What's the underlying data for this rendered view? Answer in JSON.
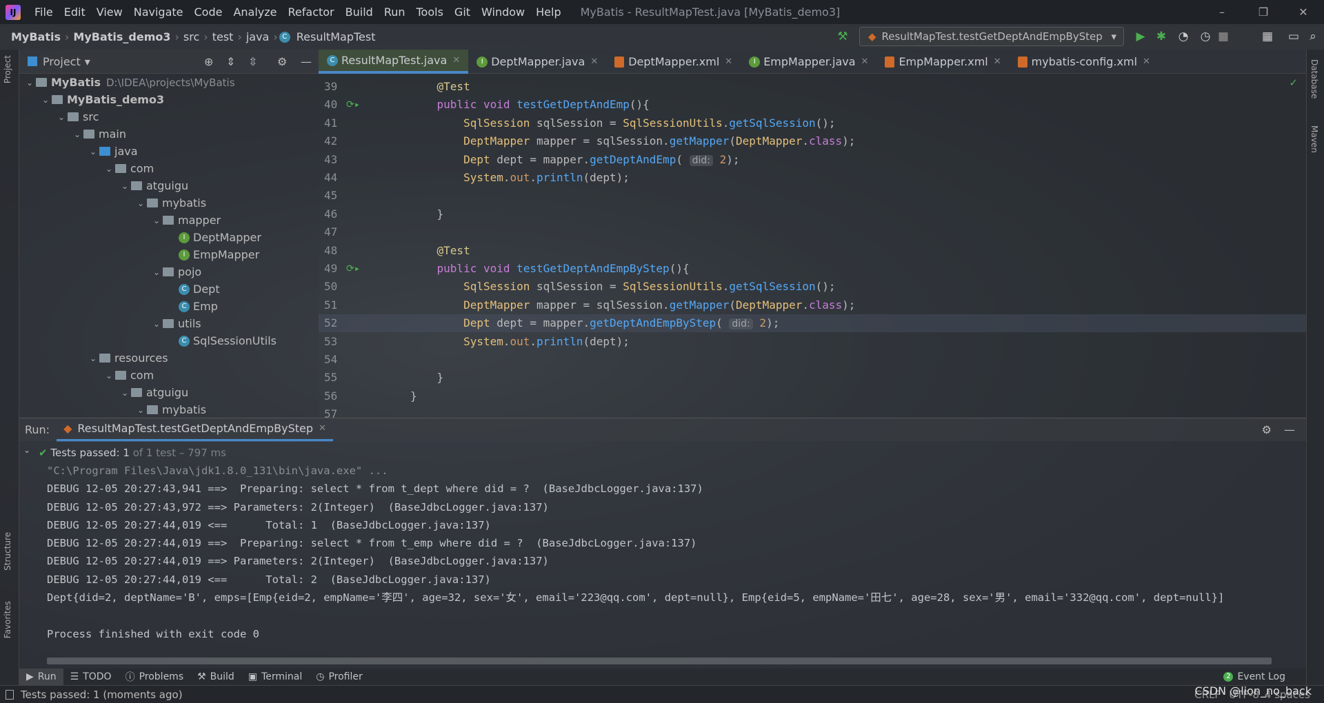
{
  "window": {
    "title": "MyBatis - ResultMapTest.java [MyBatis_demo3]",
    "logo": "IJ"
  },
  "menu": [
    "File",
    "Edit",
    "View",
    "Navigate",
    "Code",
    "Analyze",
    "Refactor",
    "Build",
    "Run",
    "Tools",
    "Git",
    "Window",
    "Help"
  ],
  "breadcrumb": [
    "MyBatis",
    "MyBatis_demo3",
    "src",
    "test",
    "java",
    "ResultMapTest"
  ],
  "run_config": "ResultMapTest.testGetDeptAndEmpByStep",
  "project_panel": {
    "title": "Project",
    "left_strip": [
      "Project",
      "Structure",
      "Favorites"
    ],
    "right_strip": [
      "Database",
      "Maven"
    ]
  },
  "tree": [
    {
      "name": "MyBatis",
      "depth": 0,
      "icon": "folder",
      "open": true,
      "path": "D:\\IDEA\\projects\\MyBatis",
      "bold": true
    },
    {
      "name": "MyBatis_demo3",
      "depth": 1,
      "icon": "folder",
      "open": true,
      "bold": true
    },
    {
      "name": "src",
      "depth": 2,
      "icon": "folder",
      "open": true
    },
    {
      "name": "main",
      "depth": 3,
      "icon": "folder",
      "open": true
    },
    {
      "name": "java",
      "depth": 4,
      "icon": "folder-blue",
      "open": true
    },
    {
      "name": "com",
      "depth": 5,
      "icon": "folder",
      "open": true
    },
    {
      "name": "atguigu",
      "depth": 6,
      "icon": "folder",
      "open": true
    },
    {
      "name": "mybatis",
      "depth": 7,
      "icon": "folder",
      "open": true
    },
    {
      "name": "mapper",
      "depth": 8,
      "icon": "folder",
      "open": true
    },
    {
      "name": "DeptMapper",
      "depth": 9,
      "icon": "interface"
    },
    {
      "name": "EmpMapper",
      "depth": 9,
      "icon": "interface"
    },
    {
      "name": "pojo",
      "depth": 8,
      "icon": "folder",
      "open": true
    },
    {
      "name": "Dept",
      "depth": 9,
      "icon": "class"
    },
    {
      "name": "Emp",
      "depth": 9,
      "icon": "class"
    },
    {
      "name": "utils",
      "depth": 8,
      "icon": "folder",
      "open": true
    },
    {
      "name": "SqlSessionUtils",
      "depth": 9,
      "icon": "class"
    },
    {
      "name": "resources",
      "depth": 4,
      "icon": "folder",
      "open": true
    },
    {
      "name": "com",
      "depth": 5,
      "icon": "folder",
      "open": true
    },
    {
      "name": "atguigu",
      "depth": 6,
      "icon": "folder",
      "open": true
    },
    {
      "name": "mybatis",
      "depth": 7,
      "icon": "folder",
      "open": true
    }
  ],
  "tabs": [
    {
      "label": "ResultMapTest.java",
      "icon": "class",
      "active": true
    },
    {
      "label": "DeptMapper.java",
      "icon": "interface"
    },
    {
      "label": "DeptMapper.xml",
      "icon": "xml"
    },
    {
      "label": "EmpMapper.java",
      "icon": "interface"
    },
    {
      "label": "EmpMapper.xml",
      "icon": "xml"
    },
    {
      "label": "mybatis-config.xml",
      "icon": "xml"
    }
  ],
  "code": [
    {
      "n": "39",
      "t": [
        [
          "    ",
          ""
        ],
        [
          "@Test",
          "an"
        ]
      ]
    },
    {
      "n": "40",
      "run": true,
      "t": [
        [
          "    ",
          ""
        ],
        [
          "public void ",
          "kw"
        ],
        [
          "testGetDeptAndEmp",
          "me"
        ],
        [
          "(){",
          ""
        ]
      ]
    },
    {
      "n": "41",
      "t": [
        [
          "        ",
          ""
        ],
        [
          "SqlSession",
          "ty"
        ],
        [
          " sqlSession = ",
          ""
        ],
        [
          "SqlSessionUtils",
          "ty"
        ],
        [
          ".",
          ""
        ],
        [
          "getSqlSession",
          "me"
        ],
        [
          "();",
          ""
        ]
      ]
    },
    {
      "n": "42",
      "t": [
        [
          "        ",
          ""
        ],
        [
          "DeptMapper",
          "ty"
        ],
        [
          " mapper = sqlSession.",
          ""
        ],
        [
          "getMapper",
          "me"
        ],
        [
          "(",
          ""
        ],
        [
          "DeptMapper",
          "ty"
        ],
        [
          ".",
          ""
        ],
        [
          "class",
          "kw"
        ],
        [
          ");",
          ""
        ]
      ]
    },
    {
      "n": "43",
      "t": [
        [
          "        ",
          ""
        ],
        [
          "Dept",
          "ty"
        ],
        [
          " dept = mapper.",
          ""
        ],
        [
          "getDeptAndEmp",
          "me"
        ],
        [
          "( ",
          ""
        ],
        [
          "did:",
          "hint"
        ],
        [
          " ",
          ""
        ],
        [
          "2",
          "nu"
        ],
        [
          ");",
          ""
        ]
      ]
    },
    {
      "n": "44",
      "t": [
        [
          "        ",
          ""
        ],
        [
          "System",
          "ty"
        ],
        [
          ".",
          ""
        ],
        [
          "out",
          "fi"
        ],
        [
          ".",
          ""
        ],
        [
          "println",
          "me"
        ],
        [
          "(dept);",
          ""
        ]
      ]
    },
    {
      "n": "45",
      "t": []
    },
    {
      "n": "46",
      "t": [
        [
          "    }",
          ""
        ]
      ]
    },
    {
      "n": "47",
      "t": []
    },
    {
      "n": "48",
      "t": [
        [
          "    ",
          ""
        ],
        [
          "@Test",
          "an"
        ]
      ]
    },
    {
      "n": "49",
      "run": true,
      "t": [
        [
          "    ",
          ""
        ],
        [
          "public void ",
          "kw"
        ],
        [
          "testGetDeptAndEmpByStep",
          "me"
        ],
        [
          "(){",
          ""
        ]
      ]
    },
    {
      "n": "50",
      "t": [
        [
          "        ",
          ""
        ],
        [
          "SqlSession",
          "ty"
        ],
        [
          " sqlSession = ",
          ""
        ],
        [
          "SqlSessionUtils",
          "ty"
        ],
        [
          ".",
          ""
        ],
        [
          "getSqlSession",
          "me"
        ],
        [
          "();",
          ""
        ]
      ]
    },
    {
      "n": "51",
      "t": [
        [
          "        ",
          ""
        ],
        [
          "DeptMapper",
          "ty"
        ],
        [
          " mapper = sqlSession.",
          ""
        ],
        [
          "getMapper",
          "me"
        ],
        [
          "(",
          ""
        ],
        [
          "DeptMapper",
          "ty"
        ],
        [
          ".",
          ""
        ],
        [
          "class",
          "kw"
        ],
        [
          ");",
          ""
        ]
      ]
    },
    {
      "n": "52",
      "cur": true,
      "t": [
        [
          "        ",
          ""
        ],
        [
          "Dept",
          "ty"
        ],
        [
          " dept = mapper.",
          ""
        ],
        [
          "getDeptAndEmpByStep",
          "me"
        ],
        [
          "( ",
          ""
        ],
        [
          "did:",
          "hint"
        ],
        [
          " ",
          ""
        ],
        [
          "2",
          "nu"
        ],
        [
          ");",
          ""
        ]
      ]
    },
    {
      "n": "53",
      "t": [
        [
          "        ",
          ""
        ],
        [
          "System",
          "ty"
        ],
        [
          ".",
          ""
        ],
        [
          "out",
          "fi"
        ],
        [
          ".",
          ""
        ],
        [
          "println",
          "me"
        ],
        [
          "(dept);",
          ""
        ]
      ]
    },
    {
      "n": "54",
      "t": []
    },
    {
      "n": "55",
      "t": [
        [
          "    }",
          ""
        ]
      ]
    },
    {
      "n": "56",
      "t": [
        [
          "}",
          ""
        ]
      ]
    },
    {
      "n": "57",
      "t": []
    }
  ],
  "run": {
    "label": "Run:",
    "tab": "ResultMapTest.testGetDeptAndEmpByStep",
    "tests_passed": "Tests passed:",
    "tests_count": "1",
    "tests_detail": "of 1 test – 797 ms",
    "console": [
      "\"C:\\Program Files\\Java\\jdk1.8.0_131\\bin\\java.exe\" ...",
      "DEBUG 12-05 20:27:43,941 ==>  Preparing: select * from t_dept where did = ?  (BaseJdbcLogger.java:137)",
      "DEBUG 12-05 20:27:43,972 ==> Parameters: 2(Integer)  (BaseJdbcLogger.java:137)",
      "DEBUG 12-05 20:27:44,019 <==      Total: 1  (BaseJdbcLogger.java:137)",
      "DEBUG 12-05 20:27:44,019 ==>  Preparing: select * from t_emp where did = ?  (BaseJdbcLogger.java:137)",
      "DEBUG 12-05 20:27:44,019 ==> Parameters: 2(Integer)  (BaseJdbcLogger.java:137)",
      "DEBUG 12-05 20:27:44,019 <==      Total: 2  (BaseJdbcLogger.java:137)",
      "Dept{did=2, deptName='B', emps=[Emp{eid=2, empName='李四', age=32, sex='女', email='223@qq.com', dept=null}, Emp{eid=5, empName='田七', age=28, sex='男', email='332@qq.com', dept=null}]",
      "",
      "Process finished with exit code 0"
    ]
  },
  "tool_tabs": [
    "Run",
    "TODO",
    "Problems",
    "Build",
    "Terminal",
    "Profiler"
  ],
  "event_log": {
    "label": "Event Log",
    "count": "2"
  },
  "status": {
    "message": "Tests passed: 1 (moments ago)",
    "line_sep": "CRLF",
    "encoding": "UTF-8",
    "indent": "4 spaces",
    "watermark": "CSDN @lion_no_back"
  },
  "colors": {
    "accent": "#4a88c7",
    "run_green": "#4caf50",
    "keyword": "#c77dd8",
    "method": "#56a8f5",
    "type": "#e5c07b"
  }
}
